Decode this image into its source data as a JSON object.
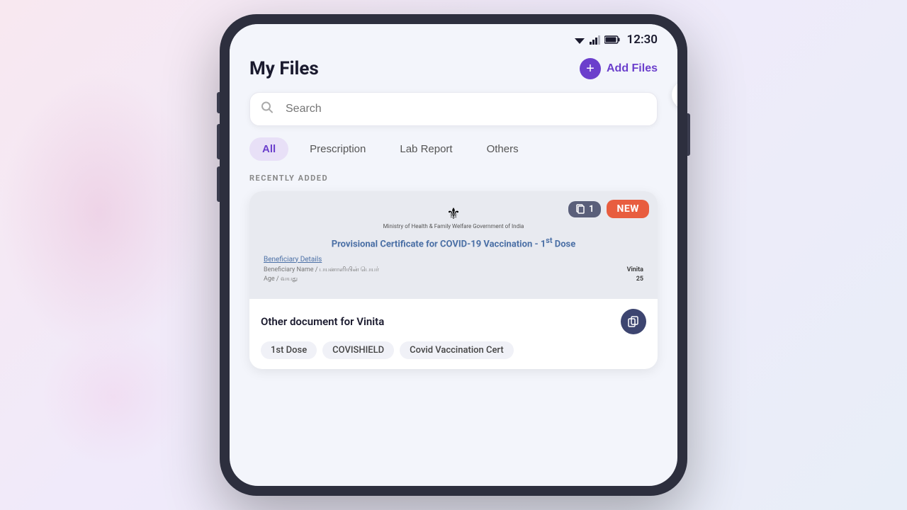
{
  "status_bar": {
    "time": "12:30"
  },
  "header": {
    "title": "My Files",
    "add_files_label": "Add Files"
  },
  "search": {
    "placeholder": "Search"
  },
  "filter_tabs": [
    {
      "id": "all",
      "label": "All",
      "active": true
    },
    {
      "id": "prescription",
      "label": "Prescription",
      "active": false
    },
    {
      "id": "lab_report",
      "label": "Lab Report",
      "active": false
    },
    {
      "id": "others",
      "label": "Others",
      "active": false
    }
  ],
  "recently_added": {
    "section_label": "RECENTLY ADDED"
  },
  "document_card": {
    "pages_count": "1",
    "new_badge": "NEW",
    "ministry_name": "Ministry of Health & Family Welfare\nGovernment of India",
    "cert_title": "Provisional Certificate for COVID-19 Vaccination - 1st Dose",
    "beneficiary_label": "Beneficiary Details",
    "beneficiary_name_label": "Beneficiary Name / பயனாளியின் பெயர்",
    "beneficiary_name_value": "Vinita",
    "age_label": "Age / வயது",
    "age_value": "25",
    "doc_name": "Other document for Vinita",
    "tags": [
      "1st Dose",
      "COVISHIELD",
      "Covid Vaccination Cert"
    ]
  },
  "icons": {
    "search": "🔍",
    "add": "+",
    "pages": "📄",
    "copy": "⧉",
    "wifi": "▼",
    "signal": "▲",
    "battery": "🔋",
    "sort": "⇅"
  }
}
